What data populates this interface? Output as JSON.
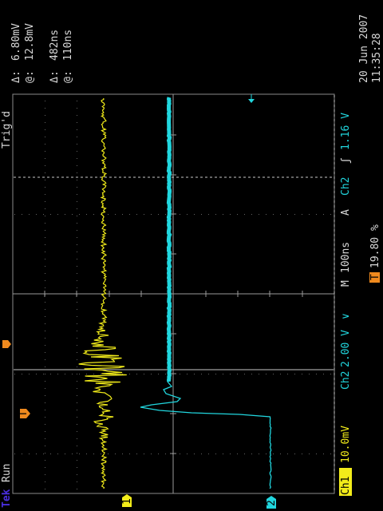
{
  "status": {
    "brand": "Tek",
    "run": "Run",
    "trig": "Trig'd"
  },
  "channels": {
    "ch1": {
      "label": "Ch1",
      "scale": "10.0mV",
      "marker": "1",
      "color": "#f2ec1a"
    },
    "ch2": {
      "label": "Ch2",
      "scale": "2.00 V",
      "coupling": "∨",
      "marker": "2",
      "color": "#21d6de"
    }
  },
  "timebase": {
    "mode": "M",
    "value": "100ns"
  },
  "trigger": {
    "mode": "A",
    "source": "Ch2",
    "slope": "ʃ",
    "level": "1.16 V",
    "marker_letter": "T",
    "position": "19.80 %"
  },
  "cursors": [
    {
      "symbol": "Δ:",
      "value": "6.80mV"
    },
    {
      "symbol": "@:",
      "value": "12.8mV"
    },
    {
      "symbol": "Δ:",
      "value": "482ns"
    },
    {
      "symbol": "@:",
      "value": "110ns"
    }
  ],
  "datetime": {
    "date": "20 Jun  2007",
    "time": "11:35:28"
  },
  "colors": {
    "graticule": "#8a8a8a",
    "cursor_line": "#c8c8c8",
    "trigger_marker": "#f08a1e",
    "info_text": "#d8d8d8"
  }
}
